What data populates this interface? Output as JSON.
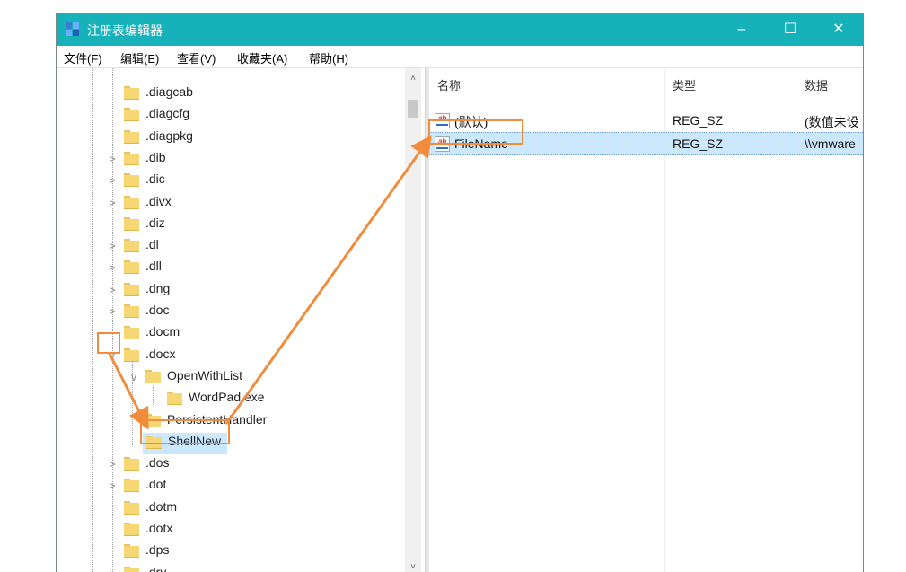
{
  "window": {
    "title": "注册表编辑器",
    "controls": {
      "minimize": "–",
      "maximize": "☐",
      "close": "✕"
    }
  },
  "menu": [
    "文件(F)",
    "编辑(E)",
    "查看(V)",
    "收藏夹(A)",
    "帮助(H)"
  ],
  "tree": {
    "items": [
      {
        "label": ".diagcab",
        "expander": ""
      },
      {
        "label": ".diagcfg",
        "expander": ""
      },
      {
        "label": ".diagpkg",
        "expander": ""
      },
      {
        "label": ".dib",
        "expander": ">"
      },
      {
        "label": ".dic",
        "expander": ">"
      },
      {
        "label": ".divx",
        "expander": ">"
      },
      {
        "label": ".diz",
        "expander": ""
      },
      {
        "label": ".dl_",
        "expander": ">"
      },
      {
        "label": ".dll",
        "expander": ">"
      },
      {
        "label": ".dng",
        "expander": ">"
      },
      {
        "label": ".doc",
        "expander": ">"
      },
      {
        "label": ".docm",
        "expander": ""
      },
      {
        "label": ".docx",
        "expander": "v"
      },
      {
        "label": "OpenWithList",
        "expander": "v"
      },
      {
        "label": "WordPad.exe",
        "expander": ""
      },
      {
        "label": "PersistentHandler",
        "expander": ""
      },
      {
        "label": "ShellNew",
        "expander": ""
      },
      {
        "label": ".dos",
        "expander": ">"
      },
      {
        "label": ".dot",
        "expander": ">"
      },
      {
        "label": ".dotm",
        "expander": ""
      },
      {
        "label": ".dotx",
        "expander": ""
      },
      {
        "label": ".dps",
        "expander": ""
      },
      {
        "label": ".drv",
        "expander": ">"
      }
    ],
    "scroll_up": "˄",
    "scroll_down": "˅"
  },
  "list": {
    "headers": {
      "name": "名称",
      "type": "类型",
      "data": "数据"
    },
    "rows": [
      {
        "icon": "string-value-icon",
        "name": "(默认)",
        "type": "REG_SZ",
        "data": "(数值未设"
      },
      {
        "icon": "string-value-icon",
        "name": "FileName",
        "type": "REG_SZ",
        "data": "\\\\vmware"
      }
    ],
    "icon_glyph": "ab"
  },
  "colors": {
    "titlebar": "#17b2b9",
    "highlight": "#f08c3b",
    "selected_row": "#cce8ff",
    "folder": "#f7d774"
  }
}
